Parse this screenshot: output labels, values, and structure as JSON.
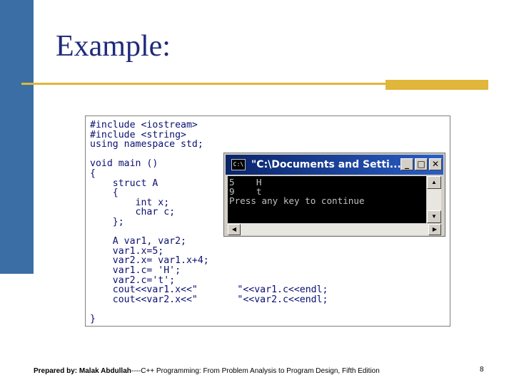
{
  "slide": {
    "title": "Example:",
    "footer_author": "Prepared by: Malak Abdullah",
    "footer_separator": "----",
    "footer_source": "C++ Programming: From Problem Analysis to Program Design, Fifth Edition",
    "page_number": "8"
  },
  "code": {
    "source": "#include <iostream>\n#include <string>\nusing namespace std;\n\nvoid main ()\n{\n    struct A\n    {\n        int x;\n        char c;\n    };\n\n    A var1, var2;\n    var1.x=5;\n    var2.x= var1.x+4;\n    var1.c= 'H';\n    var2.c='t';\n    cout<<var1.x<<\"       \"<<var1.c<<endl;\n    cout<<var2.x<<\"       \"<<var2.c<<endl;\n\n}"
  },
  "console": {
    "icon_label": "C:\\",
    "title": "\"C:\\Documents and Setti...",
    "minimize": "_",
    "maximize": "□",
    "close": "✕",
    "output": "5    H\n9    t\nPress any key to continue",
    "scroll_up": "▲",
    "scroll_down": "▼",
    "scroll_left": "◀",
    "scroll_right": "▶"
  },
  "colors": {
    "left_bar": "#3a6ea5",
    "title": "#1f2a7a",
    "accent_line": "#e0b63b",
    "code_text": "#0a1070",
    "console_title_bg": "#0a246a"
  }
}
